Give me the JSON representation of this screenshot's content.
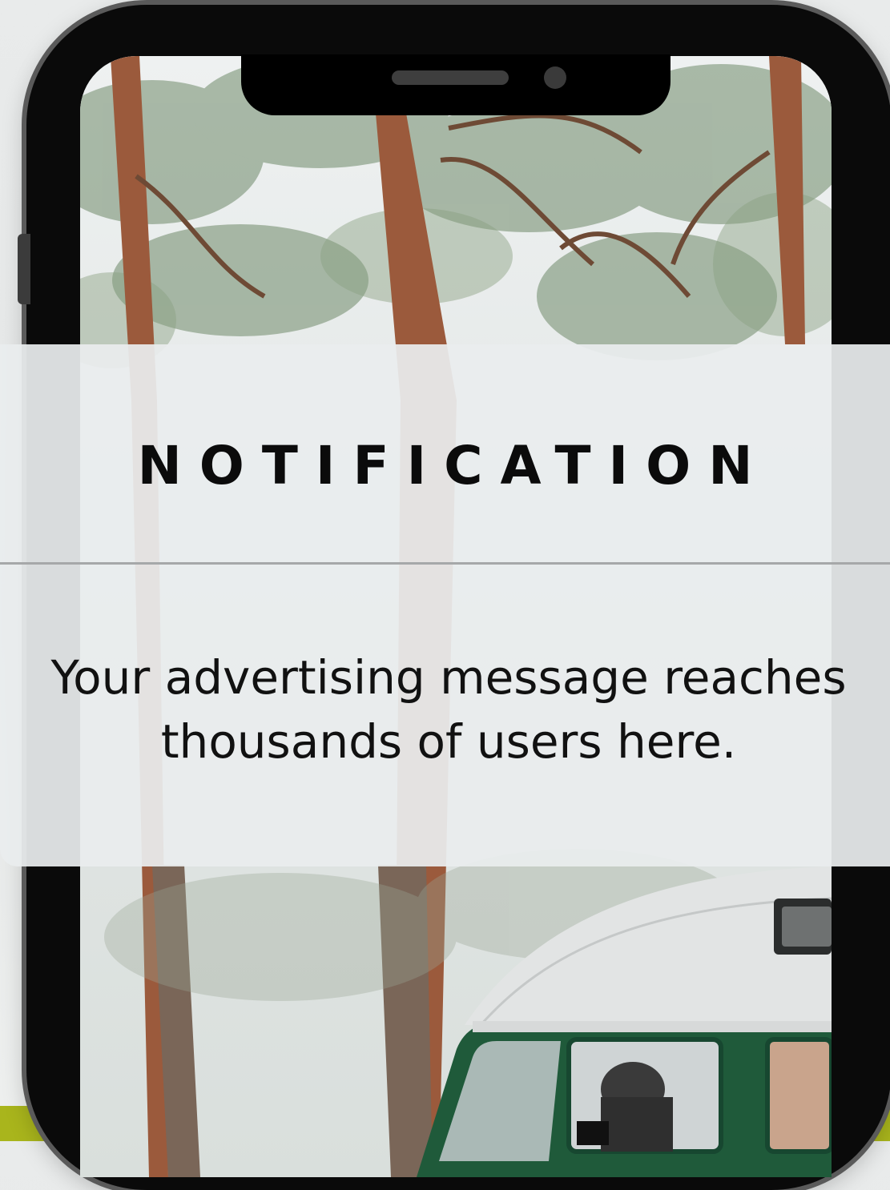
{
  "notification": {
    "title": "NOTIFICATION",
    "message": "Your advertising message reaches thousands of users here."
  },
  "colors": {
    "accent": "#a9b51c",
    "van_green": "#1f5a3a",
    "van_roof": "#e2e4e4"
  },
  "icons": {
    "speaker": "phone-speaker-icon",
    "camera": "front-camera-icon"
  }
}
